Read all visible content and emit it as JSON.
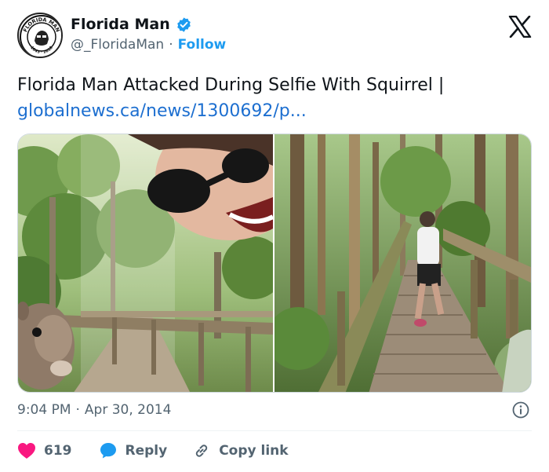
{
  "account": {
    "name": "Florida Man",
    "handle": "@_FloridaMan",
    "separator": "·",
    "follow_label": "Follow",
    "verified": true,
    "avatar_text_top": "FLORIDA MAN",
    "avatar_text_bottom": "1845 · 2018"
  },
  "tweet": {
    "text": "Florida Man Attacked During Selfie With Squirrel |",
    "link": "globalnews.ca/news/1300692/p..."
  },
  "media": {
    "photos": [
      {
        "label": "selfie-with-squirrel-photo"
      },
      {
        "label": "running-on-boardwalk-photo"
      }
    ]
  },
  "meta": {
    "time": "9:04 PM",
    "separator": "·",
    "date": "Apr 30, 2014"
  },
  "actions": {
    "likes": "619",
    "reply_label": "Reply",
    "copy_label": "Copy link"
  },
  "colors": {
    "accent": "#1d9bf0",
    "link": "#1d6fd0",
    "like": "#f91880",
    "muted": "#536471"
  },
  "icons": [
    "verified-badge-icon",
    "x-logo-icon",
    "info-icon",
    "heart-icon",
    "reply-bubble-icon",
    "link-chain-icon"
  ]
}
